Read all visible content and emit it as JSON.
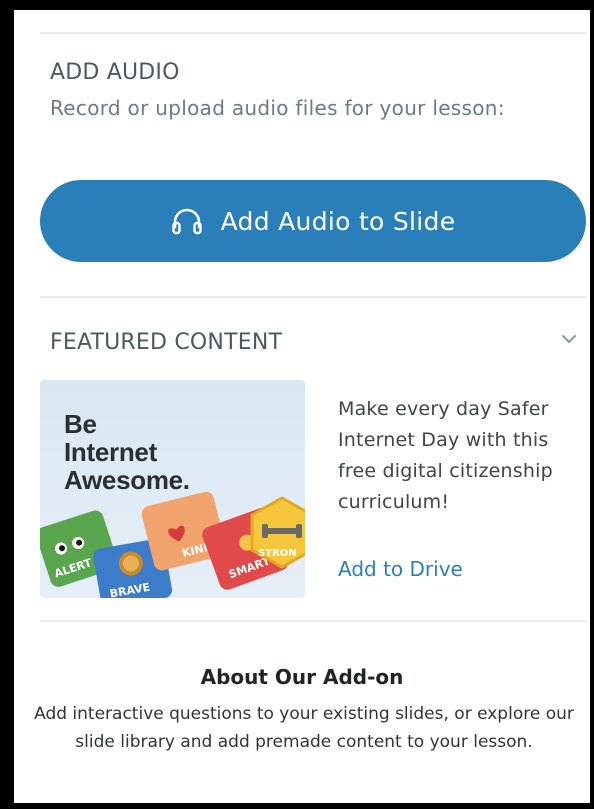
{
  "audio_section": {
    "heading": "ADD AUDIO",
    "description": "Record or upload audio files for your lesson:",
    "button_label": "Add Audio to Slide",
    "button_icon": "headphones-icon",
    "accent_color": "#2b7fb8"
  },
  "featured_section": {
    "heading": "FEATURED CONTENT",
    "toggle_icon": "chevron-down-icon",
    "image": {
      "title_line1": "Be",
      "title_line2": "Internet",
      "title_line3": "Awesome.",
      "card_labels": [
        "ALERT",
        "BRAVE",
        "KIND",
        "SMART",
        "STRONG"
      ]
    },
    "description": "Make every day Safer Internet Day with this free digital citizenship curriculum!",
    "link_label": "Add to Drive"
  },
  "about_section": {
    "title": "About Our Add-on",
    "description": "Add interactive questions to your existing slides, or explore our slide library and add premade content to your lesson."
  }
}
